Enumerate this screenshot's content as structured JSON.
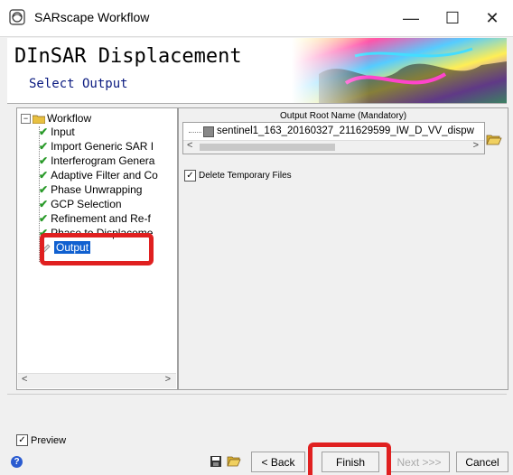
{
  "window": {
    "title": "SARscape Workflow",
    "minimize": "—",
    "maximize": "☐",
    "close": "✕"
  },
  "header": {
    "title": "DInSAR Displacement",
    "subtitle": "Select Output"
  },
  "tree": {
    "root": "Workflow",
    "items": [
      {
        "label": "Input",
        "done": true
      },
      {
        "label": "Import Generic SAR I",
        "done": true
      },
      {
        "label": "Interferogram Genera",
        "done": true
      },
      {
        "label": "Adaptive Filter and Co",
        "done": true
      },
      {
        "label": "Phase Unwrapping",
        "done": true
      },
      {
        "label": "GCP Selection",
        "done": true
      },
      {
        "label": "Refinement and Re-f",
        "done": true
      },
      {
        "label": "Phase to Displaceme",
        "done": true
      }
    ],
    "selected": "Output"
  },
  "output": {
    "root_label": "Output Root Name (Mandatory)",
    "filename": "sentinel1_163_20160327_211629599_IW_D_VV_dispw",
    "delete_temp_label": "Delete Temporary Files",
    "delete_temp_checked": true
  },
  "footer": {
    "preview_label": "Preview",
    "preview_checked": true,
    "back": "< Back",
    "finish": "Finish",
    "next": "Next >>>",
    "cancel": "Cancel"
  },
  "icons": {
    "app": "sarscape-app-icon",
    "folder": "folder-open-icon",
    "save": "save-icon",
    "help": "help-icon"
  },
  "colors": {
    "highlight": "#e02020",
    "selection": "#1060d0",
    "check": "#2a9a2a",
    "subtitle": "#0a1a80"
  }
}
